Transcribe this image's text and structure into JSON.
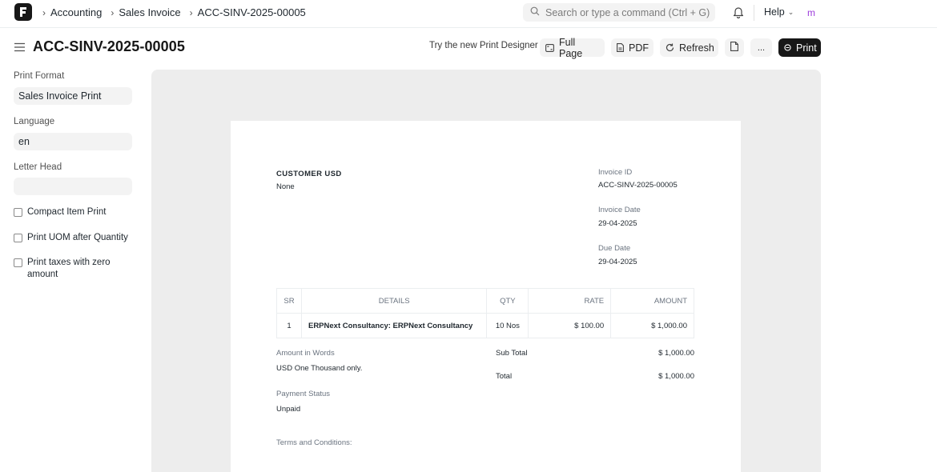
{
  "navbar": {
    "breadcrumbs": [
      "Accounting",
      "Sales Invoice",
      "ACC-SINV-2025-00005"
    ],
    "search_placeholder": "Search or type a command (Ctrl + G)",
    "help_label": "Help",
    "avatar_letter": "m"
  },
  "page": {
    "title": "ACC-SINV-2025-00005",
    "try_link": "Try the new Print Designer",
    "buttons": {
      "full_page": "Full Page",
      "pdf": "PDF",
      "refresh": "Refresh",
      "more": "...",
      "print": "Print"
    }
  },
  "sidebar": {
    "print_format_label": "Print Format",
    "print_format_value": "Sales Invoice Print",
    "language_label": "Language",
    "language_value": "en",
    "letter_head_label": "Letter Head",
    "letter_head_value": "",
    "checkboxes": [
      {
        "label": "Compact Item Print",
        "checked": false
      },
      {
        "label": "Print UOM after Quantity",
        "checked": false
      },
      {
        "label": "Print taxes with zero amount",
        "checked": false
      }
    ]
  },
  "invoice": {
    "customer_name": "CUSTOMER USD",
    "customer_sub": "None",
    "invoice_id_label": "Invoice ID",
    "invoice_id": "ACC-SINV-2025-00005",
    "invoice_date_label": "Invoice Date",
    "invoice_date": "29-04-2025",
    "due_date_label": "Due Date",
    "due_date": "29-04-2025",
    "table": {
      "headers": [
        "SR",
        "DETAILS",
        "QTY",
        "RATE",
        "AMOUNT"
      ],
      "rows": [
        [
          "1",
          "ERPNext Consultancy: ERPNext Consultancy",
          "10 Nos",
          "$ 100.00",
          "$ 1,000.00"
        ]
      ]
    },
    "amount_in_words_label": "Amount in Words",
    "amount_in_words": "USD One Thousand only.",
    "sub_total_label": "Sub Total",
    "sub_total": "$ 1,000.00",
    "total_label": "Total",
    "total": "$ 1,000.00",
    "payment_status_label": "Payment Status",
    "payment_status": "Unpaid",
    "terms_label": "Terms and Conditions:"
  }
}
